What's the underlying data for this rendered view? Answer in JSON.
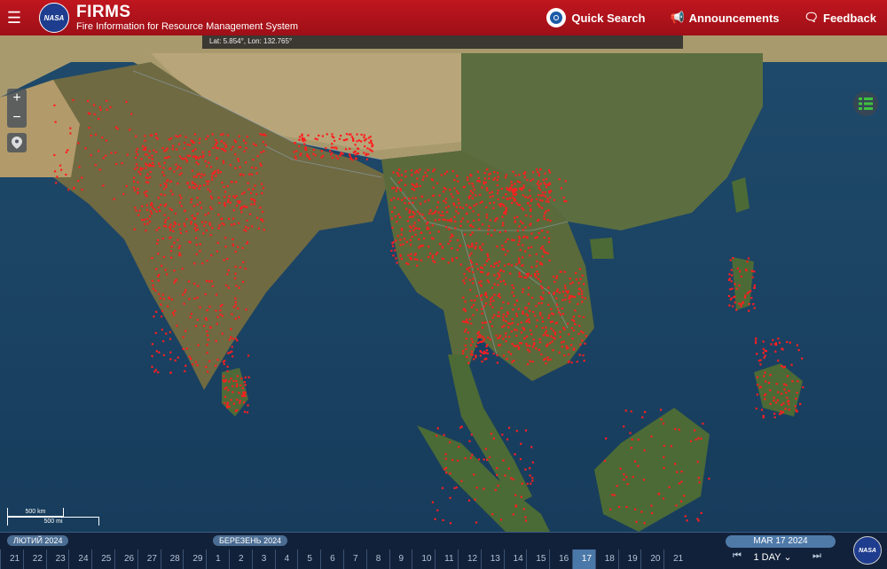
{
  "header": {
    "menu_icon": "hamburger-icon",
    "logo_text": "NASA",
    "title": "FIRMS",
    "subtitle": "Fire Information for Resource Management System",
    "quick_search": "Quick Search",
    "announcements": "Announcements",
    "feedback": "Feedback"
  },
  "coords": "Lat: 5.854°, Lon: 132.765°",
  "map": {
    "zoom_in": "+",
    "zoom_out": "−",
    "scale_km": "500 km",
    "scale_mi": "500 mi",
    "fire_color": "#ff1e1e"
  },
  "timeline": {
    "month1": "ЛЮТИЙ 2024",
    "month2": "БЕРЕЗЕНЬ 2024",
    "days": [
      "21",
      "22",
      "23",
      "24",
      "25",
      "26",
      "27",
      "28",
      "29",
      "1",
      "2",
      "3",
      "4",
      "5",
      "6",
      "7",
      "8",
      "9",
      "10",
      "11",
      "12",
      "13",
      "14",
      "15",
      "16",
      "17",
      "18",
      "19",
      "20",
      "21"
    ],
    "selected_day": "17",
    "date": "MAR 17 2024",
    "range": "1 DAY"
  }
}
